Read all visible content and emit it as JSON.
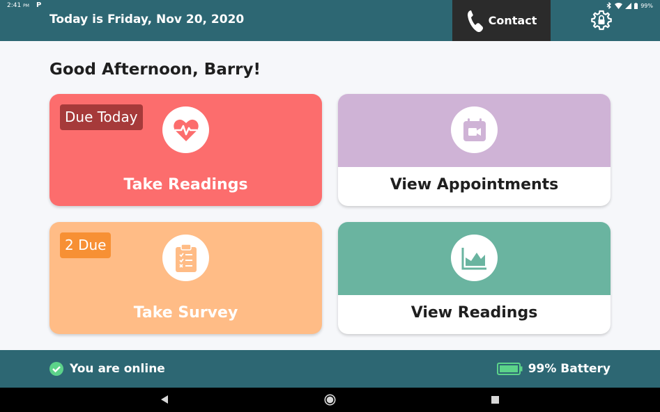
{
  "status_bar": {
    "time": "2:41",
    "ampm": "PM",
    "carrier_letter": "P",
    "battery_pct": "99%"
  },
  "header": {
    "date_text": "Today is Friday, Nov 20, 2020",
    "contact_label": "Contact"
  },
  "greeting": "Good Afternoon, Barry!",
  "cards": {
    "take_readings": {
      "label": "Take Readings",
      "badge": "Due Today",
      "color": "#fc6d6d",
      "icon": "heart-pulse-icon"
    },
    "view_appointments": {
      "label": "View Appointments",
      "color": "#cfb3d6",
      "icon": "video-calendar-icon"
    },
    "take_survey": {
      "label": "Take Survey",
      "badge": "2 Due",
      "color": "#ffbc86",
      "icon": "clipboard-checklist-icon"
    },
    "view_readings": {
      "label": "View Readings",
      "color": "#6ab4a0",
      "icon": "area-chart-icon"
    }
  },
  "footer": {
    "online_text": "You are online",
    "battery_text": "99% Battery",
    "online_color": "#5cd38a"
  },
  "colors": {
    "header_bg": "#2d6773",
    "contact_bg": "#2b2b2b",
    "page_bg": "#f6f7fa"
  }
}
